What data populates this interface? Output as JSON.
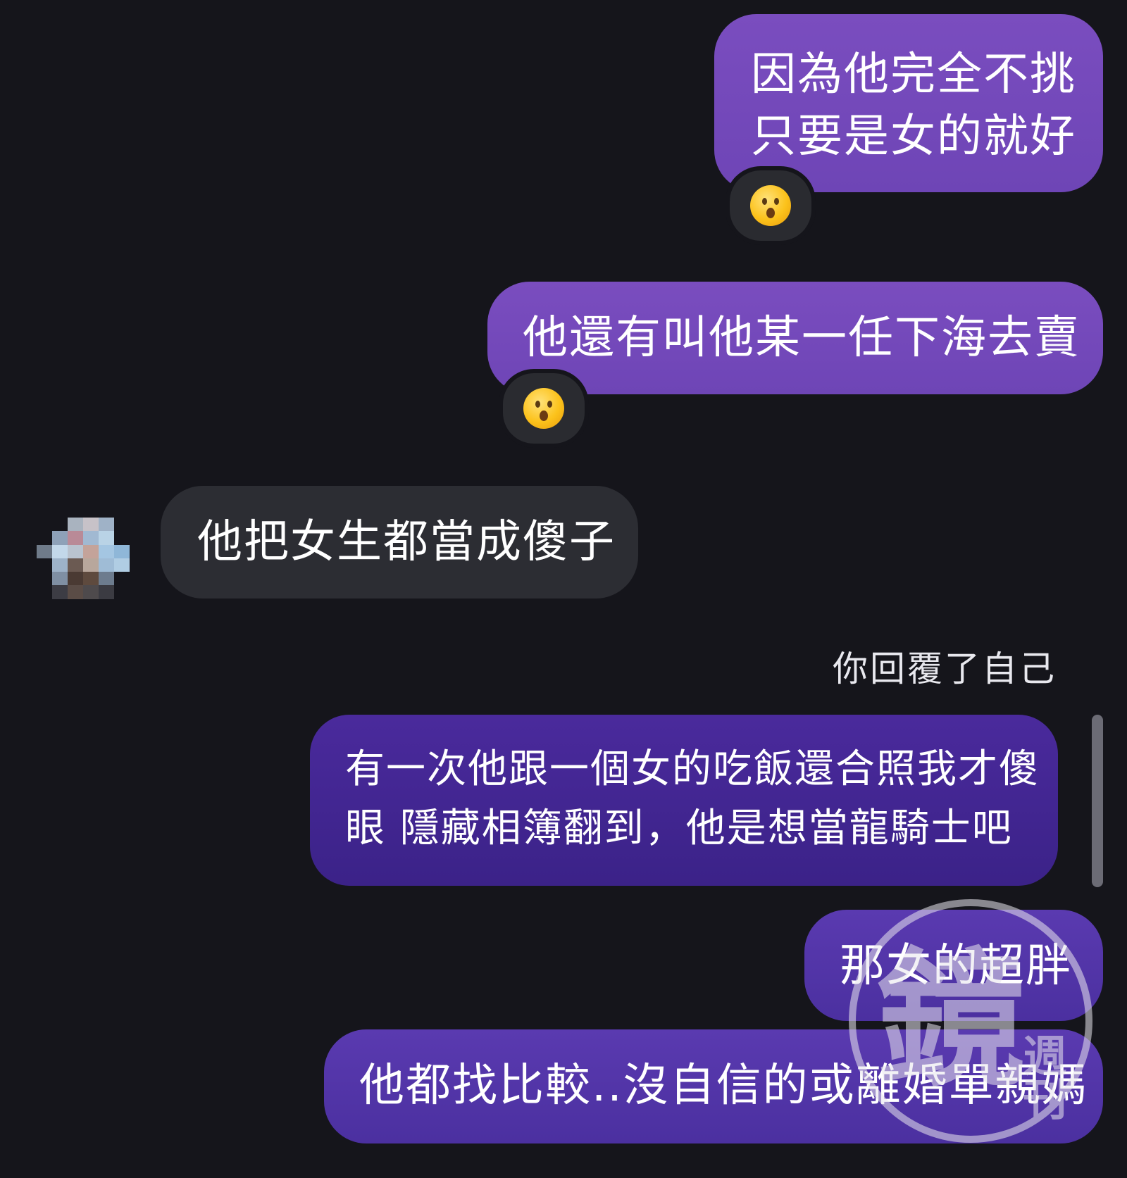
{
  "messages": [
    {
      "id": "m1",
      "sender": "self",
      "lines": [
        "因為他完全不挑",
        "只要是女的就好"
      ],
      "reaction": "😮"
    },
    {
      "id": "m2",
      "sender": "self",
      "lines": [
        "他還有叫他某一任下海去賣"
      ],
      "reaction": "😮"
    },
    {
      "id": "m3",
      "sender": "other",
      "lines": [
        "他把女生都當成傻子"
      ]
    },
    {
      "id": "m4",
      "sender": "self",
      "reply_label": "你回覆了自己",
      "lines": [
        "有一次他跟一個女的吃飯還合照我才傻",
        "眼 隱藏相簿翻到，他是想當龍騎士吧"
      ]
    },
    {
      "id": "m5",
      "sender": "self",
      "lines": [
        "那女的超胖"
      ]
    },
    {
      "id": "m6",
      "sender": "self",
      "lines": [
        "他都找比較..沒自信的或離婚單親媽"
      ]
    }
  ],
  "avatar": {
    "pixel_colors": [
      "#15151b",
      "#15151b",
      "#a9b3bf",
      "#c7c2c8",
      "#9fb2c7",
      "#15151b",
      "#15151b",
      "#8ea1b8",
      "#b98a97",
      "#a1b9d2",
      "#b9d3e6",
      "#15151b",
      "#6f7b8a",
      "#c3d8ea",
      "#b9c3cf",
      "#c4a39a",
      "#a4c6e2",
      "#8fb7d8",
      "#15151b",
      "#9db2c8",
      "#6b5a52",
      "#b8a79c",
      "#9fbcd6",
      "#b0cde3",
      "#15151b",
      "#7f8fa3",
      "#4a3a33",
      "#5e4a3e",
      "#6d7c8e",
      "#15151b",
      "#15151b",
      "#3c3c44",
      "#5a4c46",
      "#4e4a4c",
      "#3b3b42",
      "#15151b"
    ]
  },
  "watermark": {
    "main_glyph": "鏡",
    "side_glyphs": "週刊"
  },
  "colors": {
    "background": "#15151b",
    "bubble_received": "#2c2d33"
  }
}
